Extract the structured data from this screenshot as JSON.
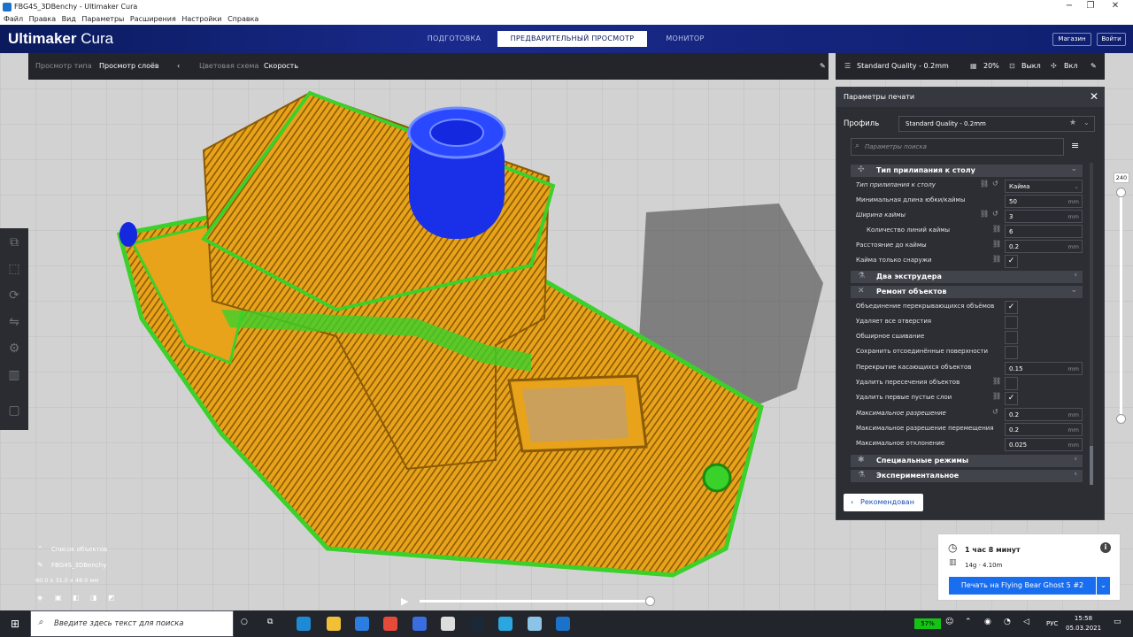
{
  "window": {
    "title": "FBG4S_3DBenchy - Ultimaker Cura",
    "controls": [
      "−",
      "❐",
      "✕"
    ]
  },
  "menu": [
    "Файл",
    "Правка",
    "Вид",
    "Параметры",
    "Расширения",
    "Настройки",
    "Справка"
  ],
  "header": {
    "brand_bold": "Ultimaker",
    "brand_light": "Cura",
    "stages": [
      "ПОДГОТОВКА",
      "ПРЕДВАРИТЕЛЬНЫЙ ПРОСМОТР",
      "МОНИТОР"
    ],
    "active_stage": "ПРЕДВАРИТЕЛЬНЫЙ ПРОСМОТР",
    "marketplace": "Магазин",
    "signin": "Войти"
  },
  "viewbar": {
    "type_label": "Просмотр типа",
    "type_value": "Просмотр слоёв",
    "color_label": "Цветовая схема",
    "color_value": "Скорость"
  },
  "setupbar": {
    "profile": "Standard Quality - 0.2mm",
    "infill": "20%",
    "support": "Выкл",
    "adhesion": "Вкл"
  },
  "panel": {
    "title": "Параметры печати",
    "profile_label": "Профиль",
    "profile_value": "Standard Quality - 0.2mm",
    "search_placeholder": "Параметры поиска",
    "recommended": "Рекомендован"
  },
  "settings": {
    "cat_adhesion": "Тип прилипания к столу",
    "adhesion_type": {
      "label": "Тип прилипания к столу",
      "value": "Кайма"
    },
    "skirt_min_len": {
      "label": "Минимальная длина юбки/каймы",
      "value": "50",
      "unit": "mm"
    },
    "brim_width": {
      "label": "Ширина каймы",
      "value": "3",
      "unit": "mm"
    },
    "brim_lines": {
      "label": "Количество линий каймы",
      "value": "6"
    },
    "brim_distance": {
      "label": "Расстояние до каймы",
      "value": "0.2",
      "unit": "mm"
    },
    "brim_outside": {
      "label": "Кайма только снаружи",
      "checked": "✓"
    },
    "cat_dual": "Два экструдера",
    "cat_mesh": "Ремонт объектов",
    "union": {
      "label": "Объединение перекрывающихся объёмов",
      "checked": "✓"
    },
    "remove_holes": {
      "label": "Удаляет все отверстия"
    },
    "extensive_stitch": {
      "label": "Обширное сшивание"
    },
    "keep_disconnected": {
      "label": "Сохранить отсоединённые поверхности"
    },
    "overlap": {
      "label": "Перекрытие касающихся объектов",
      "value": "0.15",
      "unit": "mm"
    },
    "remove_intersect": {
      "label": "Удалить пересечения объектов"
    },
    "remove_empty": {
      "label": "Удалить первые пустые слои",
      "checked": "✓"
    },
    "max_res": {
      "label": "Максимальное разрешение",
      "value": "0.2",
      "unit": "mm"
    },
    "max_travel_res": {
      "label": "Максимальное разрешение перемещения",
      "value": "0.2",
      "unit": "mm"
    },
    "max_deviation": {
      "label": "Максимальное отклонение",
      "value": "0.025",
      "unit": "mm"
    },
    "cat_special": "Специальные режимы",
    "cat_experimental": "Экспериментальное"
  },
  "layer_slider": {
    "value": "240"
  },
  "objects": {
    "title": "Список объектов",
    "name": "FBG4S_3DBenchy",
    "dims": "60.0 x 31.0 x 48.0 мм"
  },
  "print": {
    "time": "1 час 8 минут",
    "material": "14g · 4.10m",
    "button": "Печать на Flying Bear Ghost 5 #2"
  },
  "taskbar": {
    "search_placeholder": "Введите здесь текст для поиска",
    "battery": "57%",
    "lang": "РУС",
    "time": "15:58",
    "date": "05.03.2021"
  },
  "colors": {
    "accent": "#196ef0",
    "header": "#0a1a5c",
    "panel": "#2c2e33",
    "orange": "#e8a31a",
    "green": "#39d12a",
    "blue": "#1428e0"
  }
}
